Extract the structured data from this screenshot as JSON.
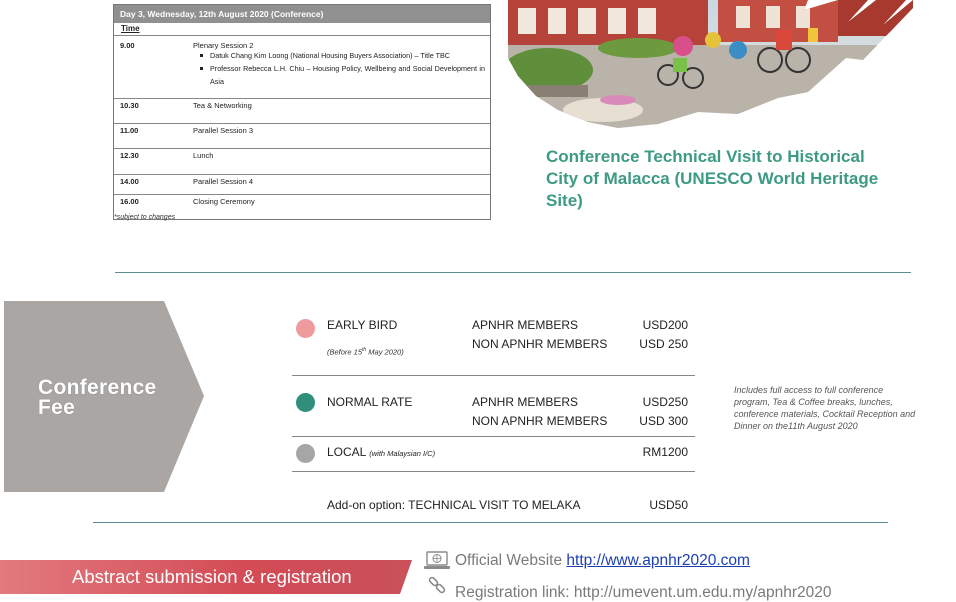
{
  "schedule": {
    "header": "Day 3, Wednesday, 12th August 2020 (Conference)",
    "time_col": "Time",
    "rows": [
      {
        "time": "9.00",
        "activity": "Plenary Session 2",
        "bullets": [
          "Datuk Chang Kim Loong (National Housing Buyers Association) – Title TBC",
          "Professor Rebecca L.H. Chiu – Housing Policy, Wellbeing and Social Development in Asia"
        ]
      },
      {
        "time": "10.30",
        "activity": "Tea & Networking"
      },
      {
        "time": "11.00",
        "activity": "Parallel Session 3"
      },
      {
        "time": "12.30",
        "activity": "Lunch"
      },
      {
        "time": "14.00",
        "activity": "Parallel Session 4"
      },
      {
        "time": "16.00",
        "activity": "Closing Ceremony"
      }
    ],
    "note": "*subject to changes"
  },
  "visit_caption": "Conference Technical Visit to Historical City of Malacca (UNESCO World Heritage Site)",
  "fee": {
    "title_line1": "Conference",
    "title_line2": "Fee",
    "early_bird": {
      "label": "EARLY BIRD",
      "sub_prefix": "(Before 15",
      "sub_sup": "th",
      "sub_suffix": " May 2020)",
      "members": "APNHR MEMBERS",
      "members_price": "USD200",
      "non_members": "NON APNHR MEMBERS",
      "non_members_price": "USD 250",
      "color": "#ef9a9c"
    },
    "normal": {
      "label": "NORMAL RATE",
      "members": "APNHR MEMBERS",
      "members_price": "USD250",
      "non_members": "NON APNHR MEMBERS",
      "non_members_price": "USD 300",
      "color": "#2f8f7a"
    },
    "local": {
      "label": "LOCAL",
      "label_note": "(with Malaysian I/C)",
      "price": "RM1200",
      "color": "#a6a6a6"
    },
    "includes": "Includes full access to full conference program, Tea & Coffee breaks, lunches, conference materials, Cocktail Reception and Dinner on the11th August 2020",
    "addon_label": "Add-on option:  TECHNICAL VISIT TO MELAKA",
    "addon_price": "USD50"
  },
  "footer": {
    "banner": "Abstract submission & registration",
    "website_label": "Official Website",
    "website_url": "http://www.apnhr2020.com",
    "registration": "Registration link: http://umevent.um.edu.my/apnhr2020"
  },
  "colors": {
    "accent_teal": "#3d9a83",
    "banner_red": "#d9545c",
    "fee_gray": "#a9a6a4"
  }
}
